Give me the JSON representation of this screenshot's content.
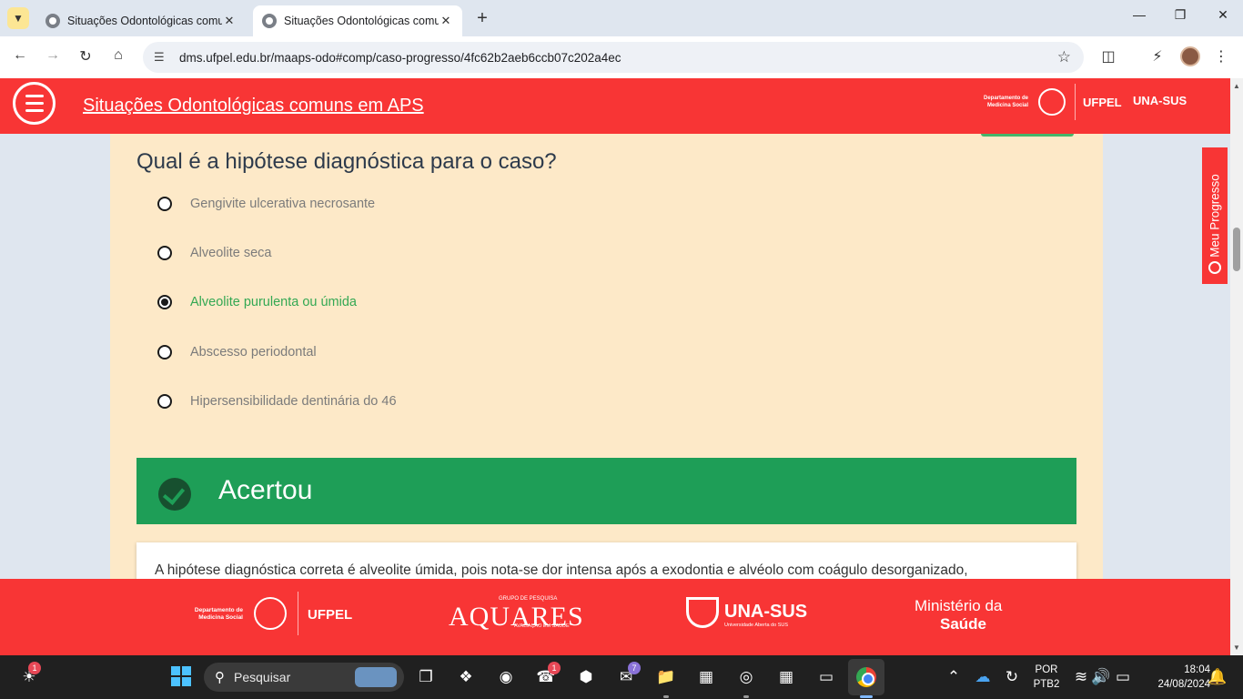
{
  "browser": {
    "tabs": [
      {
        "title": "Situações Odontológicas comu",
        "active": false
      },
      {
        "title": "Situações Odontológicas comu",
        "active": true
      }
    ],
    "new_tab_label": "+",
    "url": "dms.ufpel.edu.br/maaps-odo#comp/caso-progresso/4fc62b2aeb6ccb07c202a4ec"
  },
  "header": {
    "title": "Situações Odontológicas comuns em APS",
    "dept_label": "Departamento de Medicina Social",
    "ufpel_label": "UFPEL",
    "unasus_label": "UNA-SUS"
  },
  "question": {
    "text": "Qual é a hipótese diagnóstica para o caso?",
    "options": [
      {
        "label": "Gengivite ulcerativa necrosante",
        "selected": false
      },
      {
        "label": "Alveolite seca",
        "selected": false
      },
      {
        "label": "Alveolite purulenta ou úmida",
        "selected": true
      },
      {
        "label": "Abscesso periodontal",
        "selected": false
      },
      {
        "label": "Hipersensibilidade dentinária do 46",
        "selected": false
      }
    ]
  },
  "result": {
    "label": "Acertou",
    "explanation": "A hipótese diagnóstica correta é alveolite úmida, pois nota-se dor intensa após a exodontia e alvéolo com coágulo desorganizado,"
  },
  "progress_tab": {
    "label": "Meu Progresso"
  },
  "footer": {
    "dept_label": "Departamento de Medicina Social",
    "ufpel_label": "UFPEL",
    "aquares_top": "GRUPO DE PESQUISA",
    "aquares_label": "AQUARES",
    "aquares_sub": "AVALIAÇÃO EM SAÚDE",
    "unasus_label": "UNA-SUS",
    "unasus_sub": "Universidade Aberta do SUS",
    "ministerio_line1": "Ministério da",
    "ministerio_line2": "Saúde"
  },
  "taskbar": {
    "search_placeholder": "Pesquisar",
    "weather_badge": "1",
    "whatsapp_badge": "1",
    "mail_badge": "7",
    "language": "POR",
    "layout": "PTB2",
    "time": "18:04",
    "date": "24/08/2024"
  },
  "colors": {
    "brand_red": "#f83535",
    "card_bg": "#fde9c8",
    "success_green": "#1e9e57",
    "correct_text": "#33a853"
  }
}
